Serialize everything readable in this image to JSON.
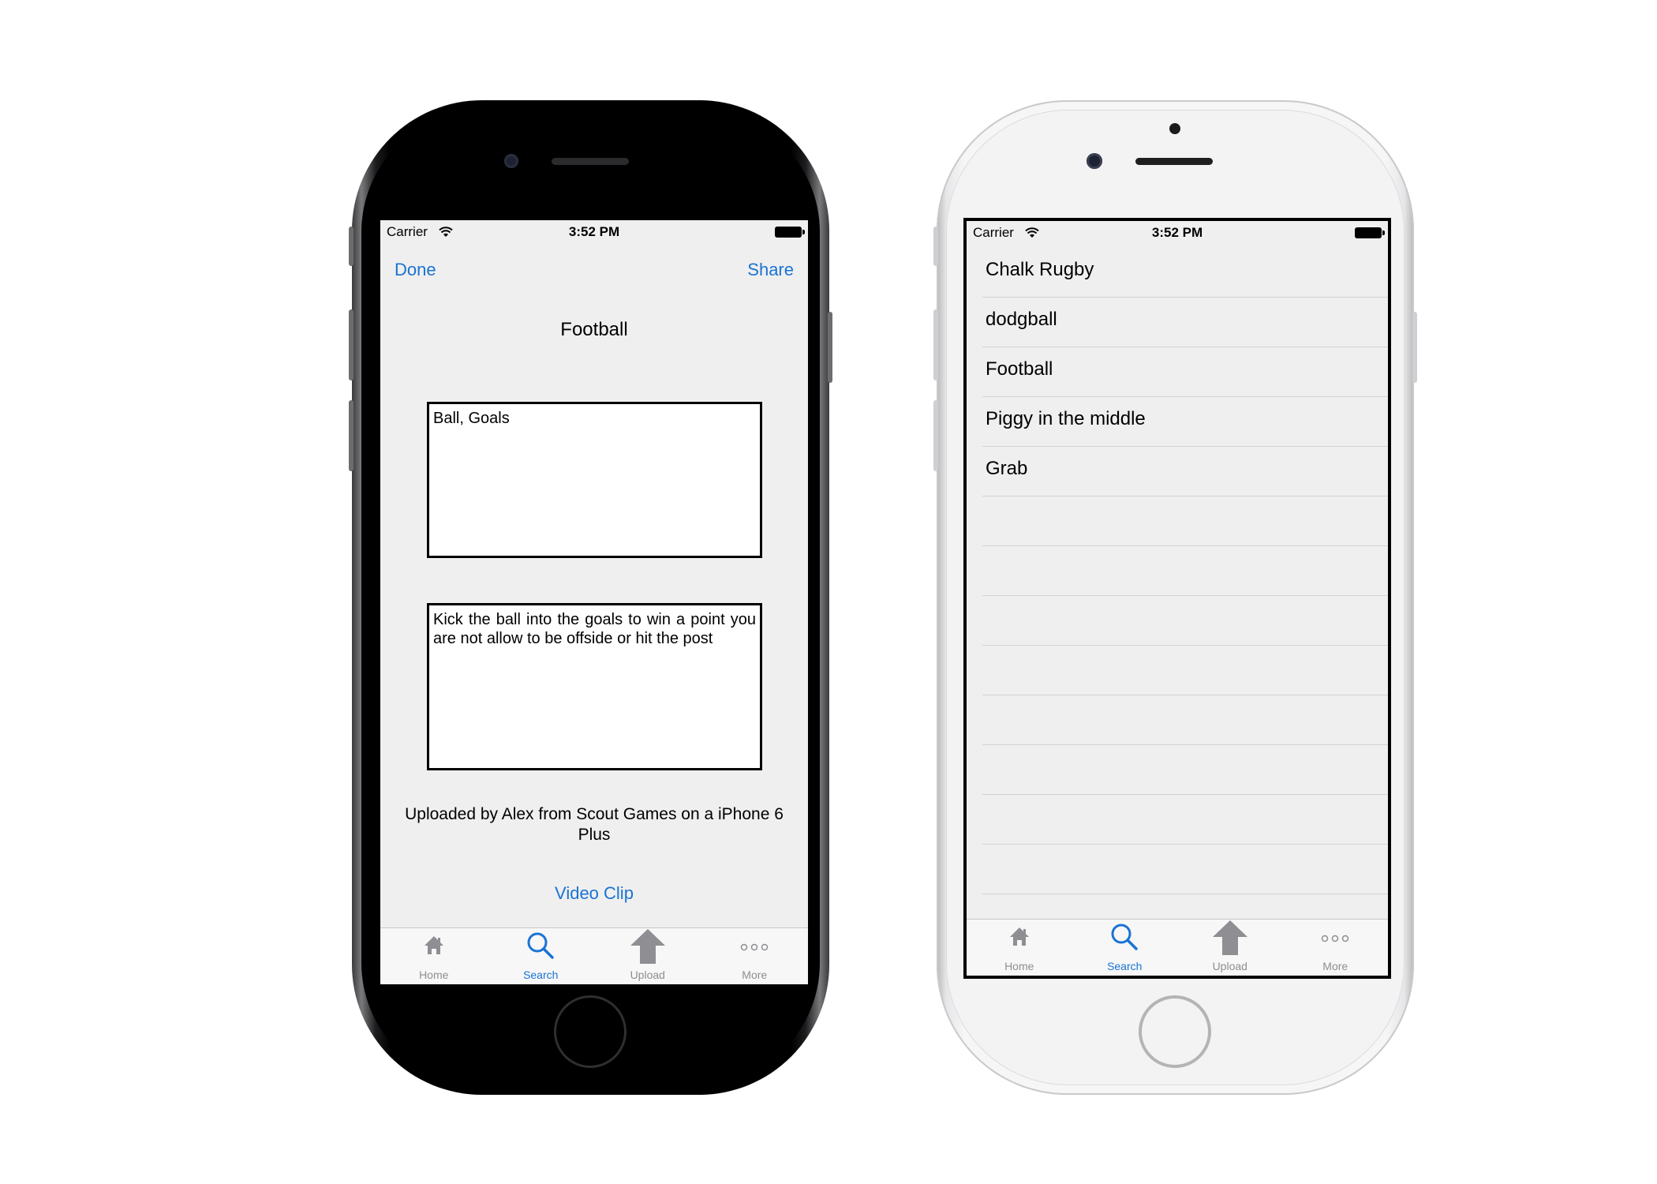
{
  "status_bar": {
    "carrier": "Carrier",
    "time": "3:52 PM"
  },
  "detail_screen": {
    "done_label": "Done",
    "share_label": "Share",
    "title": "Football",
    "equipment_text": "Ball, Goals",
    "rules_text": "Kick the ball into the goals to win a point you are not allow to be offside or hit the post",
    "uploaded_text": "Uploaded by Alex from Scout Games on a iPhone 6 Plus",
    "video_link": "Video Clip"
  },
  "list_screen": {
    "items": [
      "Chalk Rugby",
      "dodgball",
      "Football",
      "Piggy in the middle",
      "Grab"
    ]
  },
  "tab_bar": {
    "tabs": [
      {
        "label": "Home",
        "icon": "home-icon"
      },
      {
        "label": "Search",
        "icon": "search-icon",
        "active": true
      },
      {
        "label": "Upload",
        "icon": "upload-arrow-icon"
      },
      {
        "label": "More",
        "icon": "more-dots-icon"
      }
    ]
  },
  "colors": {
    "accent": "#1a73d4",
    "inactive_tab": "#8e8e93",
    "screen_bg": "#efefef"
  }
}
